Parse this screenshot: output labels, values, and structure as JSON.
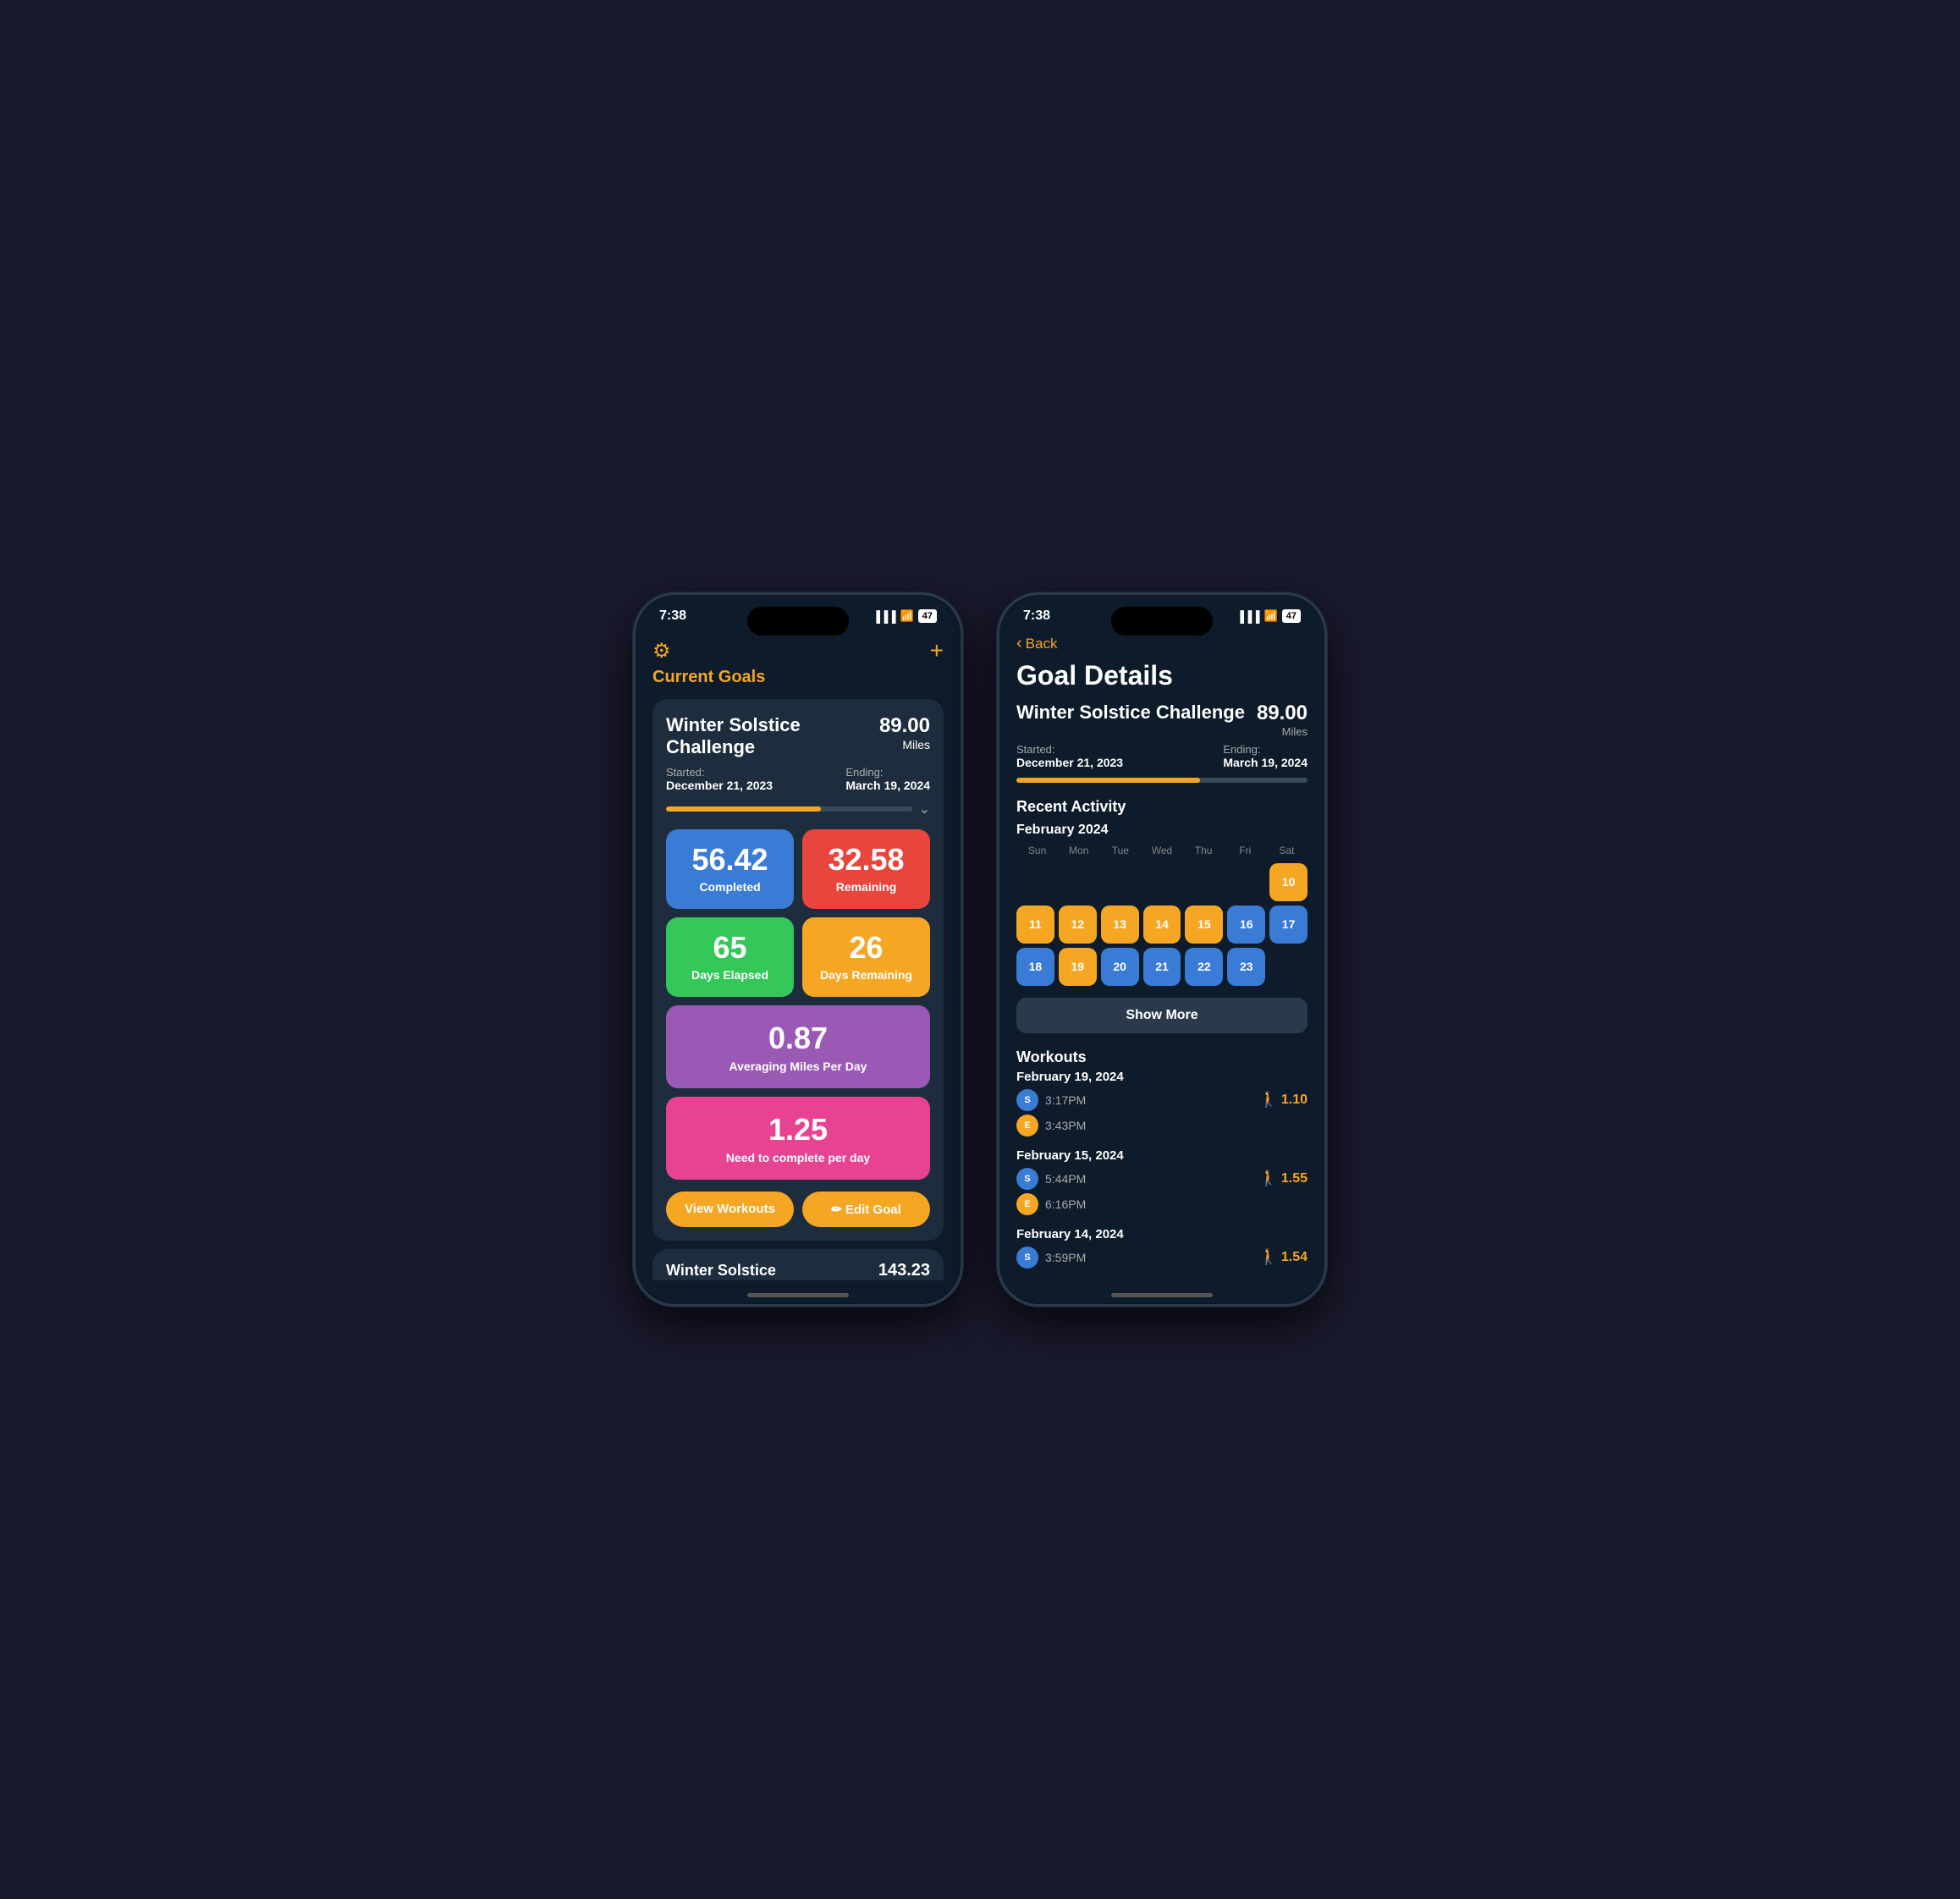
{
  "phone1": {
    "status_bar": {
      "time": "7:38",
      "signal": "▐▐▐",
      "wifi": "WiFi",
      "battery": "47"
    },
    "nav": {
      "title": "Current Goals",
      "gear_label": "⚙",
      "plus_label": "+"
    },
    "goal_card": {
      "title": "Winter Solstice Challenge",
      "value": "89.00",
      "unit": "Miles",
      "started_label": "Started:",
      "started_date": "December 21, 2023",
      "ending_label": "Ending:",
      "ending_date": "March 19, 2024",
      "progress_pct": 63
    },
    "stats": {
      "completed_value": "56.42",
      "completed_label": "Completed",
      "remaining_value": "32.58",
      "remaining_label": "Remaining",
      "days_elapsed_value": "65",
      "days_elapsed_label": "Days Elapsed",
      "days_remaining_value": "26",
      "days_remaining_label": "Days Remaining",
      "avg_value": "0.87",
      "avg_label": "Averaging Miles Per Day",
      "need_value": "1.25",
      "need_label": "Need to complete per day"
    },
    "buttons": {
      "view_workouts": "View Workouts",
      "edit_goal": "✏ Edit Goal"
    },
    "partial_card": {
      "title": "Winter Solstice",
      "value": "143.23"
    }
  },
  "phone2": {
    "status_bar": {
      "time": "7:38",
      "battery": "47"
    },
    "nav": {
      "back_label": "Back"
    },
    "page_title": "Goal Details",
    "goal": {
      "title": "Winter Solstice Challenge",
      "value": "89.00",
      "unit": "Miles",
      "started_label": "Started:",
      "started_date": "December 21, 2023",
      "ending_label": "Ending:",
      "ending_date": "March 19, 2024",
      "progress_pct": 63
    },
    "calendar": {
      "section_title": "Recent Activity",
      "month": "February 2024",
      "day_names": [
        "Sun",
        "Mon",
        "Tue",
        "Wed",
        "Thu",
        "Fri",
        "Sat"
      ],
      "days": [
        {
          "num": "",
          "type": "empty"
        },
        {
          "num": "",
          "type": "empty"
        },
        {
          "num": "",
          "type": "empty"
        },
        {
          "num": "",
          "type": "empty"
        },
        {
          "num": "",
          "type": "empty"
        },
        {
          "num": "",
          "type": "empty"
        },
        {
          "num": "10",
          "type": "active-orange"
        },
        {
          "num": "11",
          "type": "active-orange"
        },
        {
          "num": "12",
          "type": "active-orange"
        },
        {
          "num": "13",
          "type": "active-orange"
        },
        {
          "num": "14",
          "type": "active-orange"
        },
        {
          "num": "15",
          "type": "active-orange"
        },
        {
          "num": "16",
          "type": "active-blue"
        },
        {
          "num": "17",
          "type": "active-blue"
        },
        {
          "num": "18",
          "type": "active-blue"
        },
        {
          "num": "19",
          "type": "active-orange"
        },
        {
          "num": "20",
          "type": "active-blue"
        },
        {
          "num": "21",
          "type": "active-blue"
        },
        {
          "num": "22",
          "type": "active-blue"
        },
        {
          "num": "23",
          "type": "active-blue"
        }
      ],
      "show_more_label": "Show More"
    },
    "workouts": {
      "section_title": "Workouts",
      "groups": [
        {
          "date": "February 19, 2024",
          "entries": [
            {
              "icon": "S",
              "icon_type": "icon-s",
              "time": "3:17PM",
              "miles": "1.10",
              "show_miles": true
            },
            {
              "icon": "E",
              "icon_type": "icon-e",
              "time": "3:43PM",
              "miles": "",
              "show_miles": false
            }
          ]
        },
        {
          "date": "February 15, 2024",
          "entries": [
            {
              "icon": "S",
              "icon_type": "icon-s",
              "time": "5:44PM",
              "miles": "1.55",
              "show_miles": true
            },
            {
              "icon": "E",
              "icon_type": "icon-e",
              "time": "6:16PM",
              "miles": "",
              "show_miles": false
            }
          ]
        },
        {
          "date": "February 14, 2024",
          "entries": [
            {
              "icon": "S",
              "icon_type": "icon-s",
              "time": "3:59PM",
              "miles": "1.54",
              "show_miles": true
            }
          ]
        }
      ]
    }
  }
}
